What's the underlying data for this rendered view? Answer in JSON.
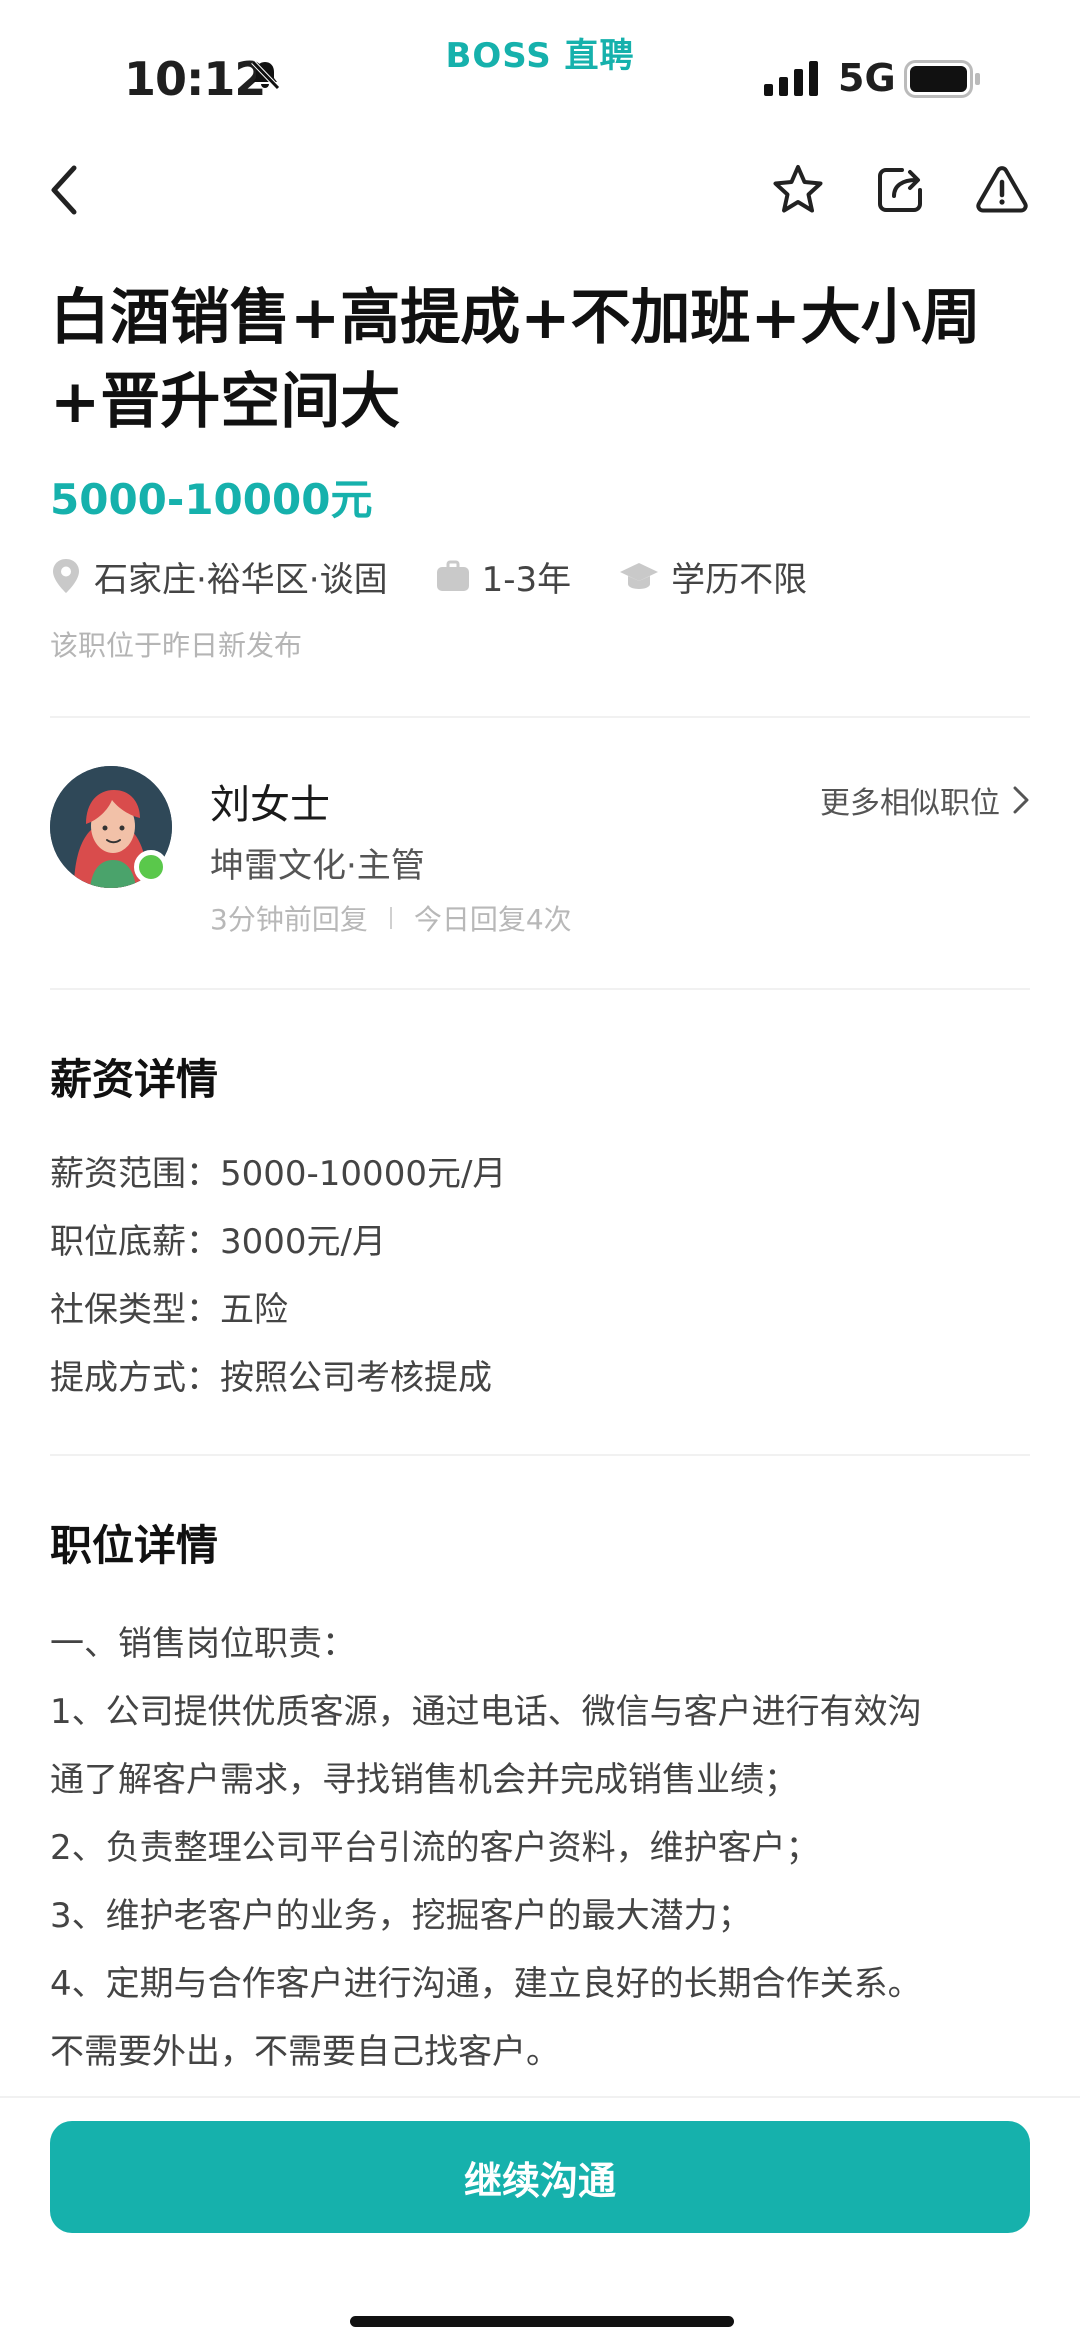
{
  "status_bar": {
    "time": "10:12",
    "brand": "BOSS 直聘",
    "network": "5G"
  },
  "job": {
    "title_line1": "白酒销售+高提成+不加班+大小周",
    "title_line2": "+晋升空间大",
    "salary": "5000-10000元",
    "location": "石家庄·裕华区·谈固",
    "experience": "1-3年",
    "education": "学历不限",
    "posted": "该职位于昨日新发布"
  },
  "recruiter": {
    "name": "刘女士",
    "company_role": "坤雷文化·主管",
    "reply_time": "3分钟前回复",
    "reply_count": "今日回复4次",
    "more_label": "更多相似职位"
  },
  "salary_details": {
    "heading": "薪资详情",
    "rows": [
      "薪资范围：5000-10000元/月",
      "职位底薪：3000元/月",
      "社保类型：五险",
      "提成方式：按照公司考核提成"
    ]
  },
  "job_details": {
    "heading": "职位详情",
    "lines": [
      "一、销售岗位职责：",
      "1、公司提供优质客源，通过电话、微信与客户进行有效沟",
      "通了解客户需求，寻找销售机会并完成销售业绩；",
      "2、负责整理公司平台引流的客户资料，维护客户；",
      "3、维护老客户的业务，挖掘客户的最大潜力；",
      "4、定期与合作客户进行沟通，建立良好的长期合作关系。",
      "不需要外出，不需要自己找客户。"
    ]
  },
  "cta": {
    "label": "继续沟通"
  },
  "colors": {
    "accent": "#16b1ac",
    "online": "#5ac84b"
  },
  "icons": [
    "back-icon",
    "star-icon",
    "share-icon",
    "report-icon",
    "location-pin-icon",
    "briefcase-icon",
    "graduation-cap-icon",
    "chevron-right-icon"
  ]
}
